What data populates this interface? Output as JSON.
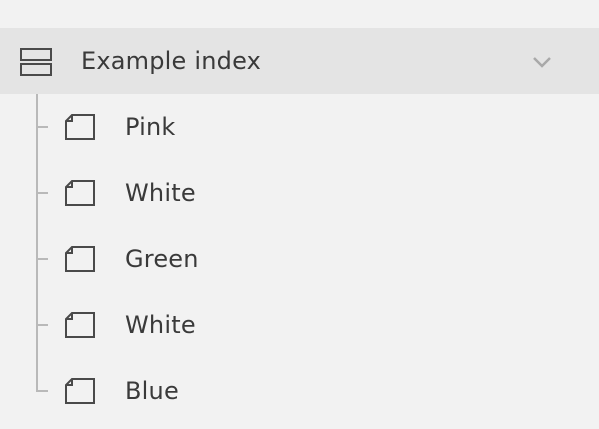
{
  "index": {
    "title": "Example index",
    "icon": "index-icon",
    "chevron_icon": "chevron-down-icon"
  },
  "pages": [
    {
      "label": "Pink",
      "icon": "page-icon"
    },
    {
      "label": "White",
      "icon": "page-icon"
    },
    {
      "label": "Green",
      "icon": "page-icon"
    },
    {
      "label": "White",
      "icon": "page-icon"
    },
    {
      "label": "Blue",
      "icon": "page-icon"
    }
  ],
  "colors": {
    "background": "#f2f2f2",
    "header_background": "#e4e4e4",
    "text": "#3a3a3a",
    "tree_line": "#b9b9b9"
  }
}
